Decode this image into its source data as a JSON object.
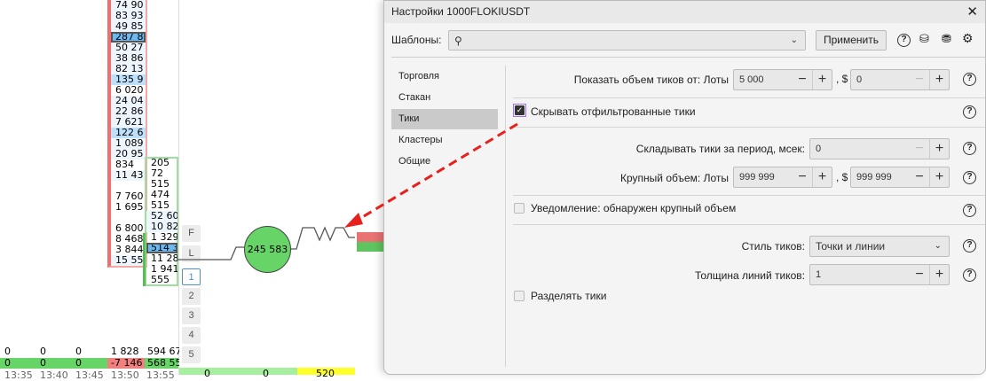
{
  "ladder": {
    "ask_column": [
      "74 90",
      "83 93",
      "49 85",
      "287 8",
      "50 27",
      "38 86",
      "82 13",
      "135 9",
      "6 020",
      "24 04",
      "22 86",
      "7 621",
      "122 6",
      "1 089",
      "20 95",
      "834",
      "11 43",
      "",
      "7 760",
      "1 695",
      "",
      "6 800",
      "8 468",
      "3 844",
      "15 55"
    ],
    "ask_styles": [
      "n",
      "n",
      "n",
      "sel",
      "n",
      "n",
      "n",
      "blue",
      "p",
      "n",
      "n",
      "n",
      "blue",
      "n",
      "n",
      "p",
      "n",
      "p",
      "p",
      "p",
      "p",
      "p",
      "p",
      "p",
      "n"
    ],
    "bid_column": [
      "205",
      "72",
      "515",
      "474",
      "515",
      "52 60",
      "10 82",
      "1 329",
      "514 3",
      "11 28",
      "1 941",
      "555"
    ],
    "bid_styles": [
      "p",
      "p",
      "p",
      "p",
      "p",
      "n",
      "n",
      "p",
      "sel",
      "p",
      "p",
      "p"
    ]
  },
  "side_buttons": [
    "F",
    "L",
    "1",
    "2",
    "3",
    "4",
    "5"
  ],
  "bubble": {
    "value": "245 583",
    "color": "#66d466"
  },
  "bottom": {
    "row1": [
      "0",
      "0",
      "0",
      "1 828",
      "594 67"
    ],
    "row2": [
      "0",
      "0",
      "0",
      "-7 146",
      "568 55"
    ],
    "times": [
      "13:35",
      "13:40",
      "13:45",
      "13:50",
      "13:55"
    ],
    "strip": [
      "0",
      "0",
      "520"
    ]
  },
  "dialog": {
    "title": "Настройки 1000FLOKIUSDT",
    "templates_label": "Шаблоны:",
    "apply_button": "Применить",
    "nav": [
      "Торговля",
      "Стакан",
      "Тики",
      "Кластеры",
      "Общие"
    ],
    "active_nav": 2,
    "show_volume_label": "Показать объем тиков от: Лоты",
    "show_volume_lots": "5 000",
    "show_volume_usd": "0",
    "dollar_sep": ", $",
    "hide_filtered_label": "Скрывать отфильтрованные тики",
    "hide_filtered_checked": true,
    "merge_label": "Складывать тики за период, мсек:",
    "merge_value": "0",
    "large_label": "Крупный объем: Лоты",
    "large_lots": "999 999",
    "large_usd": "999 999",
    "notify_label": "Уведомление: обнаружен крупный объем",
    "style_label": "Стиль тиков:",
    "style_value": "Точки и линии",
    "thickness_label": "Толщина линий тиков:",
    "thickness_value": "1",
    "split_label": "Разделять тики"
  }
}
